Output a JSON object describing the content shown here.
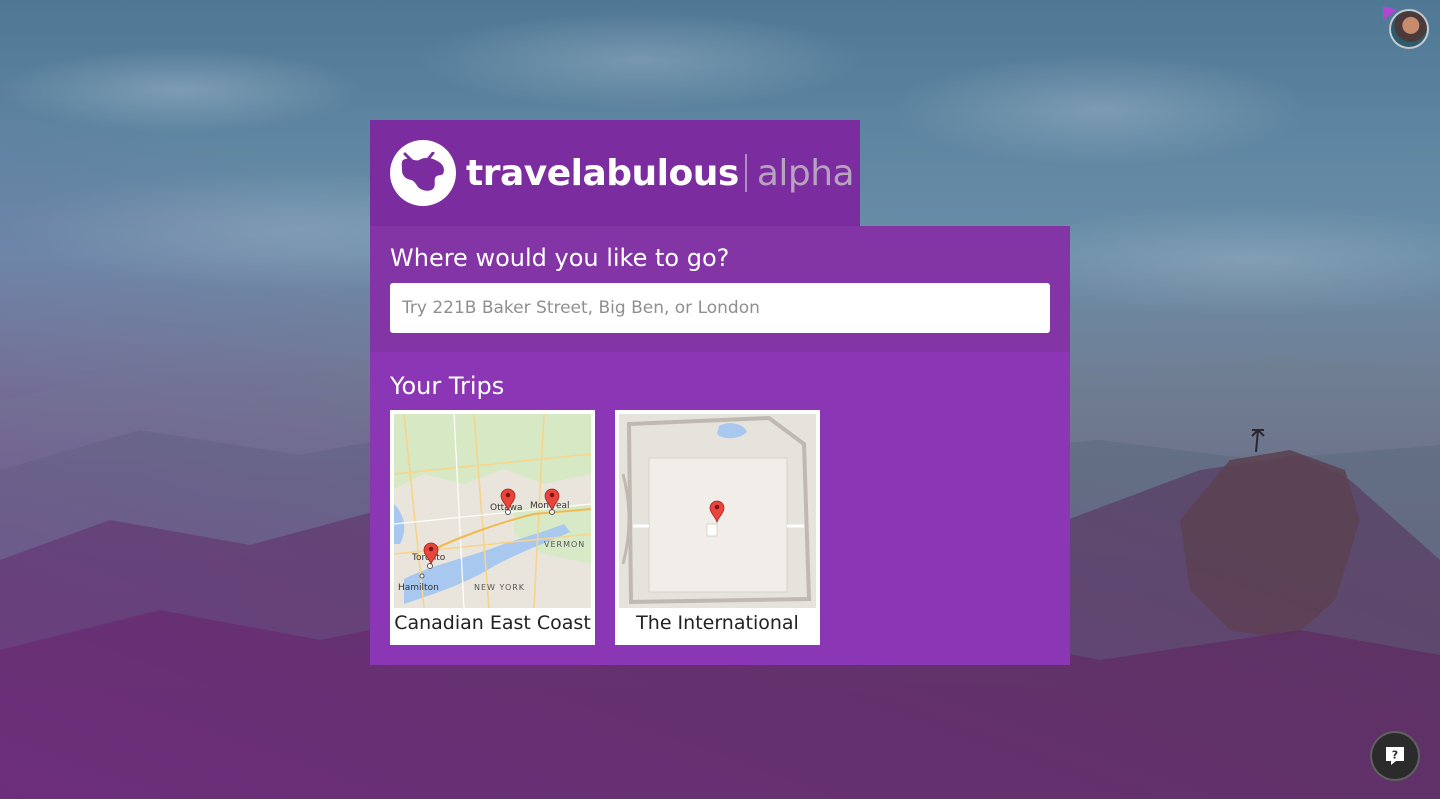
{
  "brand": {
    "name": "travelabulous",
    "tag": "alpha"
  },
  "search": {
    "heading": "Where would you like to go?",
    "placeholder": "Try 221B Baker Street, Big Ben, or London",
    "value": ""
  },
  "trips": {
    "heading": "Your Trips",
    "items": [
      {
        "title": "Canadian East Coast",
        "map_labels": [
          "Ottawa",
          "Montreal",
          "Toronto",
          "Hamilton",
          "NEW YORK",
          "VERMON"
        ]
      },
      {
        "title": "The International",
        "map_labels": []
      }
    ]
  },
  "icons": {
    "logo": "ox-head-logo-icon",
    "avatar": "user-avatar",
    "help": "help-chat-icon"
  },
  "colors": {
    "logo_bg": "#7b2c9f",
    "search_bg": "#8335a6",
    "trips_bg": "#8b37b5",
    "pin": "#e8453c"
  }
}
